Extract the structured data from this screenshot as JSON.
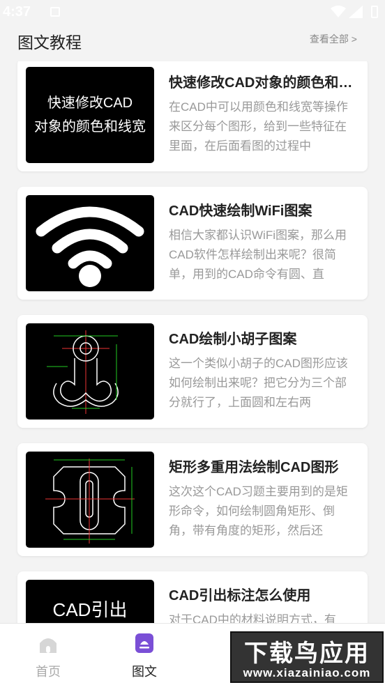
{
  "status_bar": {
    "time": "4:37"
  },
  "header": {
    "title": "图文教程",
    "more": "查看全部 >"
  },
  "articles": [
    {
      "title": "快速修改CAD对象的颜色和线宽",
      "desc": "在CAD中可以用颜色和线宽等操作来区分每个图形，给到一些特征在里面，在后面看图的过程中",
      "thumb_lines": [
        "快速修改CAD",
        "对象的颜色和线宽"
      ]
    },
    {
      "title": "CAD快速绘制WiFi图案",
      "desc": "相信大家都认识WiFi图案，那么用CAD软件怎样绘制出来呢？很简单，用到的CAD命令有圆、直"
    },
    {
      "title": "CAD绘制小胡子图案",
      "desc": "这一个类似小胡子的CAD图形应该如何绘制出来呢？把它分为三个部分就行了，上面圆和左右两"
    },
    {
      "title": "矩形多重用法绘制CAD图形",
      "desc": "这次这个CAD习题主要用到的是矩形命令，如何绘制圆角矩形、倒角，带有角度的矩形，然后还"
    },
    {
      "title": "CAD引出标注怎么使用",
      "desc": "对于CAD中的材料说明方式，有",
      "thumb_lines": [
        "CAD引出"
      ]
    }
  ],
  "tabbar": {
    "home": "首页",
    "article": "图文"
  },
  "watermark": {
    "main": "下载鸟应用",
    "url": "www.xiazainiao.com"
  }
}
